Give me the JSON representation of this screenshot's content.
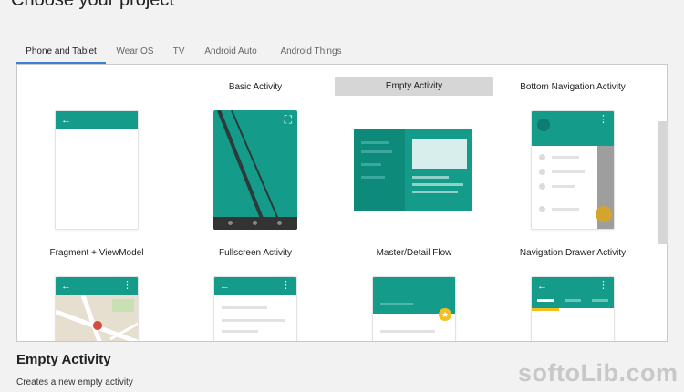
{
  "page": {
    "title": "Choose your project"
  },
  "tabs": [
    {
      "label": "Phone and Tablet"
    },
    {
      "label": "Wear OS"
    },
    {
      "label": "TV"
    },
    {
      "label": "Android Auto"
    },
    {
      "label": "Android Things"
    }
  ],
  "templates": {
    "row1": [
      "Basic Activity",
      "Empty Activity",
      "Bottom Navigation Activity"
    ],
    "row2": [
      "Fragment + ViewModel",
      "Fullscreen Activity",
      "Master/Detail Flow",
      "Navigation Drawer Activity"
    ]
  },
  "selected": {
    "name": "Empty Activity",
    "description": "Creates a new empty activity"
  },
  "watermark": "softoLib.com",
  "icons": {
    "back": "←",
    "overflow": "⋮",
    "fullscreen": "⛶",
    "star": "★"
  },
  "colors": {
    "teal": "#159b8a",
    "selection": "#d6d6d6",
    "tab_accent": "#3d7fd0",
    "amber": "#f4c020"
  }
}
